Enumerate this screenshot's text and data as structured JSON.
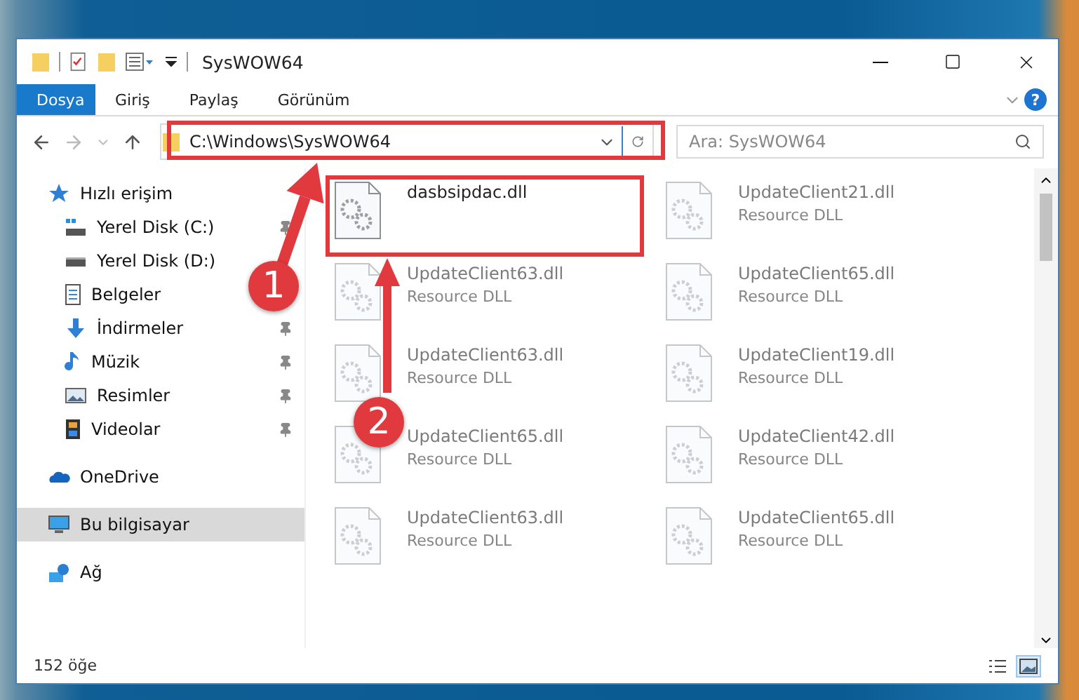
{
  "window": {
    "title": "SysWOW64"
  },
  "ribbon_tabs": [
    {
      "label": "Dosya",
      "selected": true
    },
    {
      "label": "Giriş",
      "selected": false
    },
    {
      "label": "Paylaş",
      "selected": false
    },
    {
      "label": "Görünüm",
      "selected": false
    }
  ],
  "help_button": {
    "label": "?"
  },
  "address_bar": {
    "path": "C:\\Windows\\SysWOW64"
  },
  "search": {
    "placeholder": "Ara: SysWOW64"
  },
  "sidebar": {
    "items": [
      {
        "label": "Hızlı erişim",
        "selected": false,
        "children": [
          {
            "label": "Yerel Disk (C:)",
            "pinned": true,
            "selected": false
          },
          {
            "label": "Yerel Disk (D:)",
            "pinned": false,
            "selected": false
          },
          {
            "label": "Belgeler",
            "pinned": false,
            "selected": false
          },
          {
            "label": "İndirmeler",
            "pinned": true,
            "selected": false
          },
          {
            "label": "Müzik",
            "pinned": true,
            "selected": false
          },
          {
            "label": "Resimler",
            "pinned": true,
            "selected": false
          },
          {
            "label": "Videolar",
            "pinned": true,
            "selected": false
          }
        ]
      },
      {
        "label": "OneDrive",
        "selected": false
      },
      {
        "label": "Bu bilgisayar",
        "selected": true
      },
      {
        "label": "Ağ",
        "selected": false
      }
    ]
  },
  "files": [
    {
      "name": "dasbsipdac.dll",
      "blurred": false
    },
    {
      "name": "UpdateClient21.dll",
      "type": "Resource DLL",
      "blurred": true
    },
    {
      "name": "UpdateClient63.dll",
      "type": "Resource DLL",
      "blurred": true
    },
    {
      "name": "UpdateClient65.dll",
      "type": "Resource DLL",
      "blurred": true
    },
    {
      "name": "UpdateClient63.dll",
      "type": "Resource DLL",
      "blurred": true
    },
    {
      "name": "UpdateClient19.dll",
      "type": "Resource DLL",
      "blurred": true
    },
    {
      "name": "UpdateClient65.dll",
      "type": "Resource DLL",
      "blurred": true
    },
    {
      "name": "UpdateClient42.dll",
      "type": "Resource DLL",
      "blurred": true
    },
    {
      "name": "UpdateClient63.dll",
      "type": "Resource DLL",
      "blurred": true
    },
    {
      "name": "UpdateClient65.dll",
      "type": "Resource DLL",
      "blurred": true
    }
  ],
  "status_bar": {
    "count": "152 öğe",
    "views": [
      {
        "kind": "details",
        "selected": false
      },
      {
        "kind": "large-icons",
        "selected": true
      }
    ]
  },
  "annotations": [
    {
      "label": "1"
    },
    {
      "label": "2"
    }
  ]
}
